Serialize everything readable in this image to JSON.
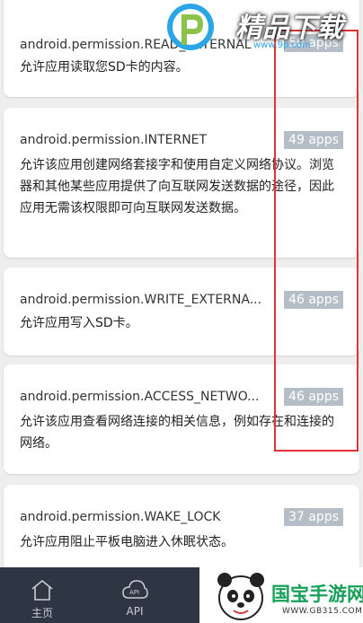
{
  "permissions": [
    {
      "name": "android.permission.READ_EXTERNAL",
      "desc": "允许应用读取您SD卡的内容。",
      "count": "50 apps"
    },
    {
      "name": "android.permission.INTERNET",
      "desc": "允许该应用创建网络套接字和使用自定义网络协议。浏览器和其他某些应用提供了向互联网发送数据的途径，因此应用无需该权限即可向互联网发送数据。",
      "count": "49 apps"
    },
    {
      "name": "android.permission.WRITE_EXTERNA...",
      "desc": "允许应用写入SD卡。",
      "count": "46 apps"
    },
    {
      "name": "android.permission.ACCESS_NETWO...",
      "desc": "允许该应用查看网络连接的相关信息，例如存在和连接的网络。",
      "count": "46 apps"
    },
    {
      "name": "android.permission.WAKE_LOCK",
      "desc": "允许应用阻止平板电脑进入休眠状态。",
      "count": "37 apps"
    }
  ],
  "tabs": [
    {
      "label": "主页",
      "icon": "home-icon"
    },
    {
      "label": "API",
      "icon": "api-icon"
    }
  ],
  "watermarks": {
    "top_brand": "精品下载",
    "top_site": "www.9p.com",
    "bottom_brand": "国宝手游网",
    "bottom_site": "WWW.GB315.COM"
  },
  "colors": {
    "badge": "#b5bec6",
    "tabbar": "#2f3643",
    "highlight": "#e23333"
  }
}
